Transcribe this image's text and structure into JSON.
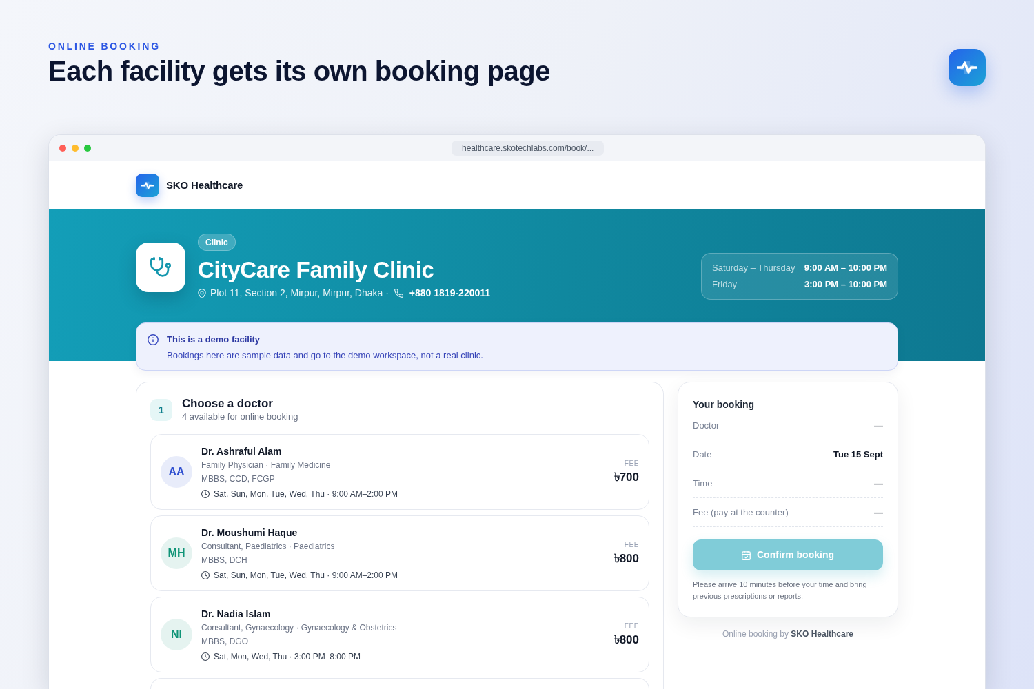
{
  "header": {
    "eyebrow": "ONLINE BOOKING",
    "title": "Each facility gets its own booking page"
  },
  "browser": {
    "url": "healthcare.skotechlabs.com/book/..."
  },
  "site_nav": {
    "brand": "SKO Healthcare"
  },
  "facility": {
    "badge": "Clinic",
    "name": "CityCare Family Clinic",
    "address": "Plot 11, Section 2, Mirpur, Mirpur, Dhaka ·",
    "phone": "+880 1819-220011",
    "hours": [
      {
        "days": "Saturday – Thursday",
        "time": "9:00 AM – 10:00 PM"
      },
      {
        "days": "Friday",
        "time": "3:00 PM – 10:00 PM"
      }
    ]
  },
  "notice": {
    "title": "This is a demo facility",
    "text": "Bookings here are sample data and go to the demo workspace, not a real clinic."
  },
  "doctor_step": {
    "step": "1",
    "title": "Choose a doctor",
    "subtitle": "4 available for online booking",
    "doctors": [
      {
        "initials": "AA",
        "color": "#2f4fd0",
        "name": "Dr. Ashraful Alam",
        "role": "Family Physician · Family Medicine",
        "degrees": "MBBS, CCD, FCGP",
        "schedule": "Sat, Sun, Mon, Tue, Wed, Thu · 9:00 AM–2:00 PM",
        "fee_label": "FEE",
        "fee": "৳700",
        "selected": false
      },
      {
        "initials": "MH",
        "color": "#0f9477",
        "name": "Dr. Moushumi Haque",
        "role": "Consultant, Paediatrics · Paediatrics",
        "degrees": "MBBS, DCH",
        "schedule": "Sat, Sun, Mon, Tue, Wed, Thu · 9:00 AM–2:00 PM",
        "fee_label": "FEE",
        "fee": "৳800",
        "selected": false
      },
      {
        "initials": "NI",
        "color": "#0f9477",
        "name": "Dr. Nadia Islam",
        "role": "Consultant, Gynaecology · Gynaecology & Obstetrics",
        "degrees": "MBBS, DGO",
        "schedule": "Sat, Mon, Wed, Thu · 3:00 PM–8:00 PM",
        "fee_label": "FEE",
        "fee": "৳800",
        "selected": false
      }
    ]
  },
  "summary": {
    "title": "Your booking",
    "rows": [
      {
        "label": "Doctor",
        "value": "—"
      },
      {
        "label": "Date",
        "value": "Tue 15 Sept"
      },
      {
        "label": "Time",
        "value": "—"
      },
      {
        "label": "Fee (pay at the counter)",
        "value": "—"
      }
    ],
    "button": {
      "label": "Confirm booking",
      "disabled": true
    },
    "note": "Please arrive 10 minutes before your time and bring previous prescriptions or reports."
  },
  "footer": "Online booking by **SKO Healthcare**"
}
